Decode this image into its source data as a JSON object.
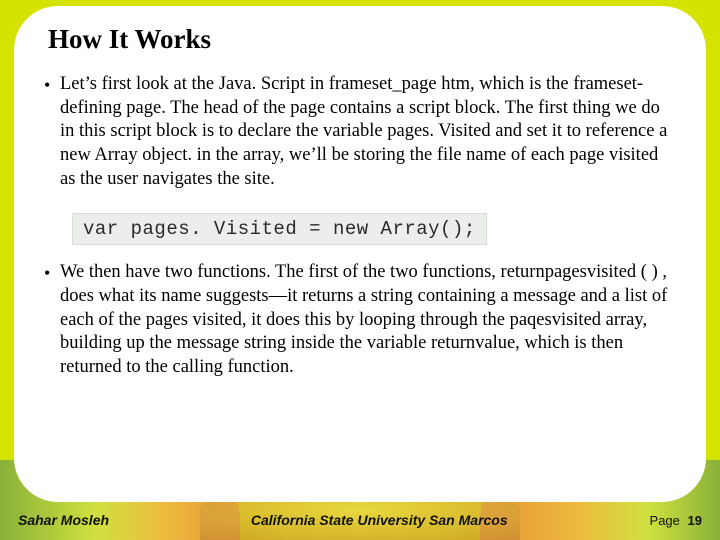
{
  "title": "How It Works",
  "bullets": [
    "Let’s first look at the Java. Script in frameset_page htm, which is the frameset-defining page. The head of the page contains a script block. The first thing we do in this script block is to declare the variable pages. Visited and set it to reference a new Array object. in the array, we’ll be storing the file name of each page visited as the user navigates the site.",
    "We then have two functions. The first of the two functions, returnpagesvisited ( ) , does what its name suggests—it returns a string containing a message and a list of each of the pages visited, it does this by looping through the paqesvisited array, building up the message string inside the variable returnvalue, which is then returned to the calling function."
  ],
  "code": "var pages. Visited = new Array();",
  "footer": {
    "author": "Sahar Mosleh",
    "university": "California State University San Marcos",
    "page_label": "Page",
    "page_number": "19"
  }
}
